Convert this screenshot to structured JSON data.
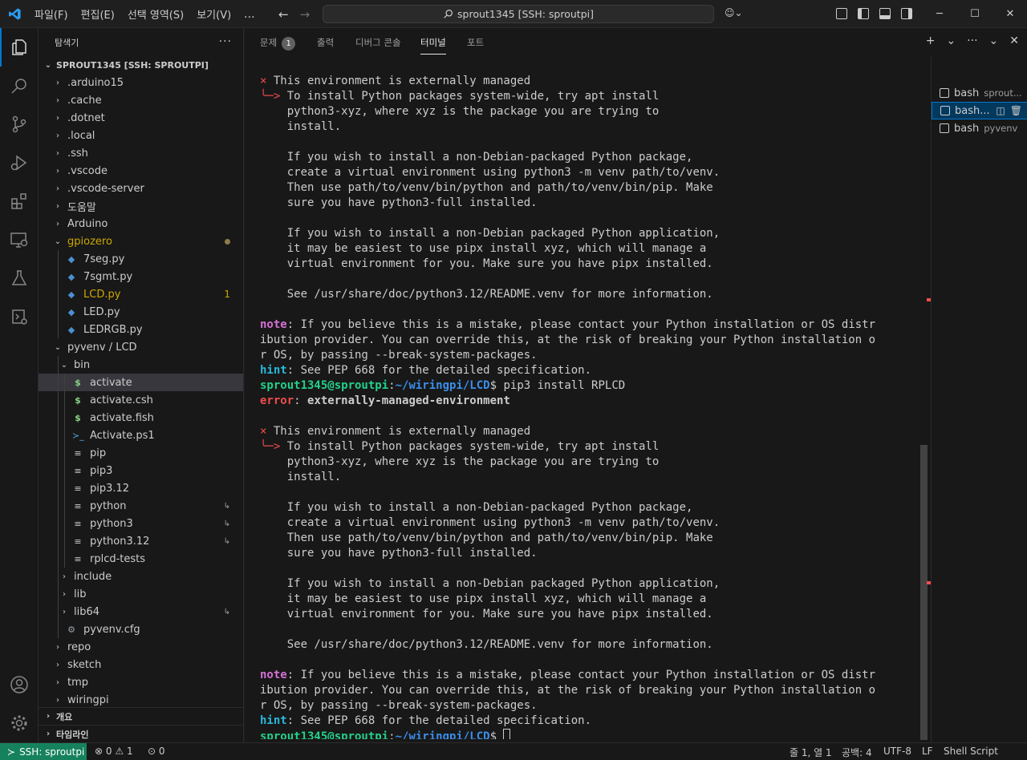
{
  "window": {
    "menus": [
      "파일(F)",
      "편집(E)",
      "선택 영역(S)",
      "보기(V)",
      "..."
    ],
    "search_text": "sprout1345 [SSH: sproutpi]",
    "controls": [
      "─",
      "☐",
      "✕"
    ]
  },
  "sidebar": {
    "title": "탐색기",
    "more": "···",
    "root": "SPROUT1345 [SSH: SPROUTPI]",
    "items": [
      {
        "name": ".arduino15",
        "kind": "folder",
        "depth": 0,
        "open": false
      },
      {
        "name": ".cache",
        "kind": "folder",
        "depth": 0,
        "open": false
      },
      {
        "name": ".dotnet",
        "kind": "folder",
        "depth": 0,
        "open": false
      },
      {
        "name": ".local",
        "kind": "folder",
        "depth": 0,
        "open": false
      },
      {
        "name": ".ssh",
        "kind": "folder",
        "depth": 0,
        "open": false
      },
      {
        "name": ".vscode",
        "kind": "folder",
        "depth": 0,
        "open": false
      },
      {
        "name": ".vscode-server",
        "kind": "folder",
        "depth": 0,
        "open": false
      },
      {
        "name": "도움말",
        "kind": "folder",
        "depth": 0,
        "open": false
      },
      {
        "name": "Arduino",
        "kind": "folder",
        "depth": 0,
        "open": false
      },
      {
        "name": "gpiozero",
        "kind": "folder",
        "depth": 0,
        "open": true,
        "color": "#cca700",
        "modified_dot": true
      },
      {
        "name": "7seg.py",
        "kind": "py",
        "depth": 1
      },
      {
        "name": "7sgmt.py",
        "kind": "py",
        "depth": 1
      },
      {
        "name": "LCD.py",
        "kind": "py",
        "depth": 1,
        "color": "#cca700",
        "badge": "1"
      },
      {
        "name": "LED.py",
        "kind": "py",
        "depth": 1
      },
      {
        "name": "LEDRGB.py",
        "kind": "py",
        "depth": 1
      },
      {
        "name": "pyvenv / LCD",
        "kind": "folder",
        "depth": 0,
        "open": true
      },
      {
        "name": "bin",
        "kind": "folder",
        "depth": 1,
        "open": true
      },
      {
        "name": "activate",
        "kind": "sh",
        "depth": 2,
        "selected": true
      },
      {
        "name": "activate.csh",
        "kind": "sh",
        "depth": 2
      },
      {
        "name": "activate.fish",
        "kind": "sh",
        "depth": 2
      },
      {
        "name": "Activate.ps1",
        "kind": "ps",
        "depth": 2
      },
      {
        "name": "pip",
        "kind": "txt",
        "depth": 2
      },
      {
        "name": "pip3",
        "kind": "txt",
        "depth": 2
      },
      {
        "name": "pip3.12",
        "kind": "txt",
        "depth": 2
      },
      {
        "name": "python",
        "kind": "txt",
        "depth": 2,
        "symlink": true
      },
      {
        "name": "python3",
        "kind": "txt",
        "depth": 2,
        "symlink": true
      },
      {
        "name": "python3.12",
        "kind": "txt",
        "depth": 2,
        "symlink": true
      },
      {
        "name": "rplcd-tests",
        "kind": "txt",
        "depth": 2
      },
      {
        "name": "include",
        "kind": "folder",
        "depth": 1,
        "open": false
      },
      {
        "name": "lib",
        "kind": "folder",
        "depth": 1,
        "open": false
      },
      {
        "name": "lib64",
        "kind": "folder",
        "depth": 1,
        "open": false,
        "symlink": true
      },
      {
        "name": "pyvenv.cfg",
        "kind": "cfg",
        "depth": 1
      },
      {
        "name": "repo",
        "kind": "folder",
        "depth": 0,
        "open": false
      },
      {
        "name": "sketch",
        "kind": "folder",
        "depth": 0,
        "open": false
      },
      {
        "name": "tmp",
        "kind": "folder",
        "depth": 0,
        "open": false
      },
      {
        "name": "wiringpi",
        "kind": "folder",
        "depth": 0,
        "open": false
      }
    ],
    "sections": [
      "개요",
      "타임라인"
    ]
  },
  "panel": {
    "tabs": [
      {
        "label": "문제",
        "count": "1"
      },
      {
        "label": "출력"
      },
      {
        "label": "디버그 콘솔"
      },
      {
        "label": "터미널",
        "active": true
      },
      {
        "label": "포트"
      }
    ],
    "tools": [
      "+",
      "⌄",
      "···",
      "⌄",
      "✕"
    ]
  },
  "terminal": {
    "lines": [
      [
        {
          "t": "× ",
          "c": "red"
        },
        {
          "t": "This environment is externally managed"
        }
      ],
      [
        {
          "t": "╰─> ",
          "c": "red"
        },
        {
          "t": "To install Python packages system-wide, try apt install"
        }
      ],
      [
        {
          "t": "    python3-xyz, where xyz is the package you are trying to"
        }
      ],
      [
        {
          "t": "    install."
        }
      ],
      [
        {
          "t": ""
        }
      ],
      [
        {
          "t": "    If you wish to install a non-Debian-packaged Python package,"
        }
      ],
      [
        {
          "t": "    create a virtual environment using python3 -m venv path/to/venv."
        }
      ],
      [
        {
          "t": "    Then use path/to/venv/bin/python and path/to/venv/bin/pip. Make"
        }
      ],
      [
        {
          "t": "    sure you have python3-full installed."
        }
      ],
      [
        {
          "t": ""
        }
      ],
      [
        {
          "t": "    If you wish to install a non-Debian packaged Python application,"
        }
      ],
      [
        {
          "t": "    it may be easiest to use pipx install xyz, which will manage a"
        }
      ],
      [
        {
          "t": "    virtual environment for you. Make sure you have pipx installed."
        }
      ],
      [
        {
          "t": ""
        }
      ],
      [
        {
          "t": "    See /usr/share/doc/python3.12/README.venv for more information."
        }
      ],
      [
        {
          "t": ""
        }
      ],
      [
        {
          "t": "note",
          "c": "mag bold"
        },
        {
          "t": ": If you believe this is a mistake, please contact your Python installation or OS distr"
        }
      ],
      [
        {
          "t": "ibution provider. You can override this, at the risk of breaking your Python installation o"
        }
      ],
      [
        {
          "t": "r OS, by passing --break-system-packages."
        }
      ],
      [
        {
          "t": "hint",
          "c": "cyan bold"
        },
        {
          "t": ": See PEP 668 for the detailed specification."
        }
      ],
      [
        {
          "t": "sprout1345@sproutpi",
          "c": "grn bold"
        },
        {
          "t": ":"
        },
        {
          "t": "~/wiringpi/LCD",
          "c": "blu bold"
        },
        {
          "t": "$ pip3 install RPLCD"
        }
      ],
      [
        {
          "t": "error",
          "c": "red bold"
        },
        {
          "t": ": "
        },
        {
          "t": "externally-managed-environment",
          "c": "bold"
        }
      ],
      [
        {
          "t": ""
        }
      ],
      [
        {
          "t": "× ",
          "c": "red"
        },
        {
          "t": "This environment is externally managed"
        }
      ],
      [
        {
          "t": "╰─> ",
          "c": "red"
        },
        {
          "t": "To install Python packages system-wide, try apt install"
        }
      ],
      [
        {
          "t": "    python3-xyz, where xyz is the package you are trying to"
        }
      ],
      [
        {
          "t": "    install."
        }
      ],
      [
        {
          "t": ""
        }
      ],
      [
        {
          "t": "    If you wish to install a non-Debian-packaged Python package,"
        }
      ],
      [
        {
          "t": "    create a virtual environment using python3 -m venv path/to/venv."
        }
      ],
      [
        {
          "t": "    Then use path/to/venv/bin/python and path/to/venv/bin/pip. Make"
        }
      ],
      [
        {
          "t": "    sure you have python3-full installed."
        }
      ],
      [
        {
          "t": ""
        }
      ],
      [
        {
          "t": "    If you wish to install a non-Debian packaged Python application,"
        }
      ],
      [
        {
          "t": "    it may be easiest to use pipx install xyz, which will manage a"
        }
      ],
      [
        {
          "t": "    virtual environment for you. Make sure you have pipx installed."
        }
      ],
      [
        {
          "t": ""
        }
      ],
      [
        {
          "t": "    See /usr/share/doc/python3.12/README.venv for more information."
        }
      ],
      [
        {
          "t": ""
        }
      ],
      [
        {
          "t": "note",
          "c": "mag bold"
        },
        {
          "t": ": If you believe this is a mistake, please contact your Python installation or OS distr"
        }
      ],
      [
        {
          "t": "ibution provider. You can override this, at the risk of breaking your Python installation o"
        }
      ],
      [
        {
          "t": "r OS, by passing --break-system-packages."
        }
      ],
      [
        {
          "t": "hint",
          "c": "cyan bold"
        },
        {
          "t": ": See PEP 668 for the detailed specification."
        }
      ],
      [
        {
          "t": "sprout1345@sproutpi",
          "c": "grn bold"
        },
        {
          "t": ":"
        },
        {
          "t": "~/wiringpi/LCD",
          "c": "blu bold"
        },
        {
          "t": "$ "
        }
      ]
    ],
    "decorations": {
      "20": "err",
      "43": "neutral"
    },
    "cursor_line": 43
  },
  "terminal_list": [
    {
      "label": "bash",
      "sub": "sprout..."
    },
    {
      "label": "bash...",
      "selected": true
    },
    {
      "label": "bash",
      "sub": "pyvenv"
    }
  ],
  "statusbar": {
    "remote": "SSH: sproutpi",
    "errors": "0",
    "warnings": "1",
    "ports": "0",
    "position": "줄 1, 열 1",
    "spaces": "공백: 4",
    "encoding": "UTF-8",
    "eol": "LF",
    "language": "Shell Script"
  }
}
